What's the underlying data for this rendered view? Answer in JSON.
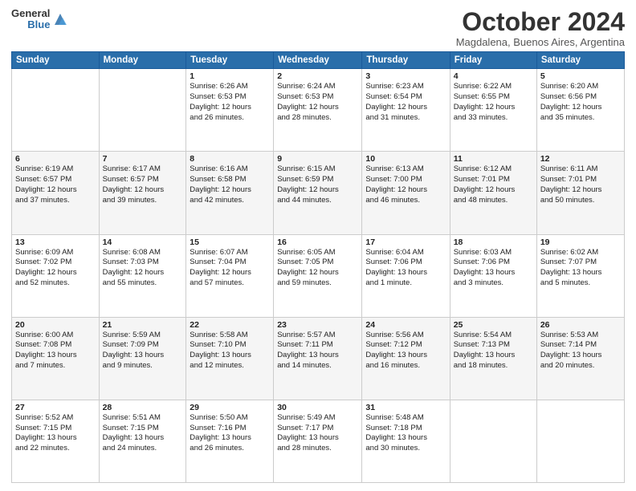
{
  "logo": {
    "general": "General",
    "blue": "Blue"
  },
  "header": {
    "month": "October 2024",
    "location": "Magdalena, Buenos Aires, Argentina"
  },
  "weekdays": [
    "Sunday",
    "Monday",
    "Tuesday",
    "Wednesday",
    "Thursday",
    "Friday",
    "Saturday"
  ],
  "weeks": [
    [
      {
        "day": "",
        "info": ""
      },
      {
        "day": "",
        "info": ""
      },
      {
        "day": "1",
        "info": "Sunrise: 6:26 AM\nSunset: 6:53 PM\nDaylight: 12 hours\nand 26 minutes."
      },
      {
        "day": "2",
        "info": "Sunrise: 6:24 AM\nSunset: 6:53 PM\nDaylight: 12 hours\nand 28 minutes."
      },
      {
        "day": "3",
        "info": "Sunrise: 6:23 AM\nSunset: 6:54 PM\nDaylight: 12 hours\nand 31 minutes."
      },
      {
        "day": "4",
        "info": "Sunrise: 6:22 AM\nSunset: 6:55 PM\nDaylight: 12 hours\nand 33 minutes."
      },
      {
        "day": "5",
        "info": "Sunrise: 6:20 AM\nSunset: 6:56 PM\nDaylight: 12 hours\nand 35 minutes."
      }
    ],
    [
      {
        "day": "6",
        "info": "Sunrise: 6:19 AM\nSunset: 6:57 PM\nDaylight: 12 hours\nand 37 minutes."
      },
      {
        "day": "7",
        "info": "Sunrise: 6:17 AM\nSunset: 6:57 PM\nDaylight: 12 hours\nand 39 minutes."
      },
      {
        "day": "8",
        "info": "Sunrise: 6:16 AM\nSunset: 6:58 PM\nDaylight: 12 hours\nand 42 minutes."
      },
      {
        "day": "9",
        "info": "Sunrise: 6:15 AM\nSunset: 6:59 PM\nDaylight: 12 hours\nand 44 minutes."
      },
      {
        "day": "10",
        "info": "Sunrise: 6:13 AM\nSunset: 7:00 PM\nDaylight: 12 hours\nand 46 minutes."
      },
      {
        "day": "11",
        "info": "Sunrise: 6:12 AM\nSunset: 7:01 PM\nDaylight: 12 hours\nand 48 minutes."
      },
      {
        "day": "12",
        "info": "Sunrise: 6:11 AM\nSunset: 7:01 PM\nDaylight: 12 hours\nand 50 minutes."
      }
    ],
    [
      {
        "day": "13",
        "info": "Sunrise: 6:09 AM\nSunset: 7:02 PM\nDaylight: 12 hours\nand 52 minutes."
      },
      {
        "day": "14",
        "info": "Sunrise: 6:08 AM\nSunset: 7:03 PM\nDaylight: 12 hours\nand 55 minutes."
      },
      {
        "day": "15",
        "info": "Sunrise: 6:07 AM\nSunset: 7:04 PM\nDaylight: 12 hours\nand 57 minutes."
      },
      {
        "day": "16",
        "info": "Sunrise: 6:05 AM\nSunset: 7:05 PM\nDaylight: 12 hours\nand 59 minutes."
      },
      {
        "day": "17",
        "info": "Sunrise: 6:04 AM\nSunset: 7:06 PM\nDaylight: 13 hours\nand 1 minute."
      },
      {
        "day": "18",
        "info": "Sunrise: 6:03 AM\nSunset: 7:06 PM\nDaylight: 13 hours\nand 3 minutes."
      },
      {
        "day": "19",
        "info": "Sunrise: 6:02 AM\nSunset: 7:07 PM\nDaylight: 13 hours\nand 5 minutes."
      }
    ],
    [
      {
        "day": "20",
        "info": "Sunrise: 6:00 AM\nSunset: 7:08 PM\nDaylight: 13 hours\nand 7 minutes."
      },
      {
        "day": "21",
        "info": "Sunrise: 5:59 AM\nSunset: 7:09 PM\nDaylight: 13 hours\nand 9 minutes."
      },
      {
        "day": "22",
        "info": "Sunrise: 5:58 AM\nSunset: 7:10 PM\nDaylight: 13 hours\nand 12 minutes."
      },
      {
        "day": "23",
        "info": "Sunrise: 5:57 AM\nSunset: 7:11 PM\nDaylight: 13 hours\nand 14 minutes."
      },
      {
        "day": "24",
        "info": "Sunrise: 5:56 AM\nSunset: 7:12 PM\nDaylight: 13 hours\nand 16 minutes."
      },
      {
        "day": "25",
        "info": "Sunrise: 5:54 AM\nSunset: 7:13 PM\nDaylight: 13 hours\nand 18 minutes."
      },
      {
        "day": "26",
        "info": "Sunrise: 5:53 AM\nSunset: 7:14 PM\nDaylight: 13 hours\nand 20 minutes."
      }
    ],
    [
      {
        "day": "27",
        "info": "Sunrise: 5:52 AM\nSunset: 7:15 PM\nDaylight: 13 hours\nand 22 minutes."
      },
      {
        "day": "28",
        "info": "Sunrise: 5:51 AM\nSunset: 7:15 PM\nDaylight: 13 hours\nand 24 minutes."
      },
      {
        "day": "29",
        "info": "Sunrise: 5:50 AM\nSunset: 7:16 PM\nDaylight: 13 hours\nand 26 minutes."
      },
      {
        "day": "30",
        "info": "Sunrise: 5:49 AM\nSunset: 7:17 PM\nDaylight: 13 hours\nand 28 minutes."
      },
      {
        "day": "31",
        "info": "Sunrise: 5:48 AM\nSunset: 7:18 PM\nDaylight: 13 hours\nand 30 minutes."
      },
      {
        "day": "",
        "info": ""
      },
      {
        "day": "",
        "info": ""
      }
    ]
  ]
}
